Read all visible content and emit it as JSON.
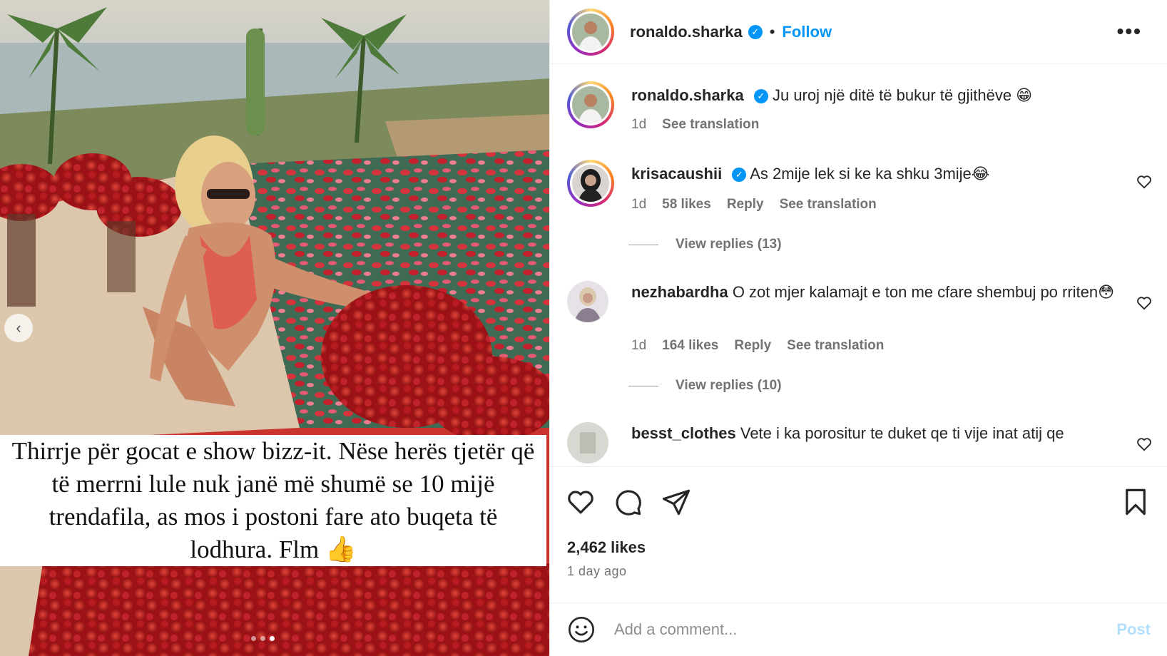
{
  "media": {
    "caption": "Thirrje për gocat e show bizz-it. Nëse herës tjetër që të merrni lule nuk janë më shumë se 10 mijë trendafila, as mos i postoni fare ato buqeta të lodhura. Flm 👍",
    "prev_icon": "chevron-left-icon",
    "dots_total": 3,
    "dots_active": 3
  },
  "header": {
    "username": "ronaldo.sharka",
    "separator": "•",
    "follow_label": "Follow",
    "more_label": "•••"
  },
  "caption_comment": {
    "username": "ronaldo.sharka",
    "text": "Ju uroj një ditë të bukur të gjithëve 😁",
    "time": "1d",
    "see_translation": "See translation"
  },
  "comments": [
    {
      "username": "krisacaushii",
      "verified": true,
      "text": "As 2mije lek si ke ka shku 3mije😂",
      "time": "1d",
      "likes": "58 likes",
      "reply": "Reply",
      "see_translation": "See translation",
      "view_replies": "View replies (13)"
    },
    {
      "username": "nezhabardha",
      "verified": false,
      "text": "O zot mjer kalamajt e ton me cfare shembuj po rriten😳",
      "time": "1d",
      "likes": "164 likes",
      "reply": "Reply",
      "see_translation": "See translation",
      "view_replies": "View replies (10)"
    },
    {
      "username": "besst_clothes",
      "verified": false,
      "text": "Vete i ka porositur te duket qe ti vije inat atij qe"
    }
  ],
  "actions": {
    "likes": "2,462 likes",
    "time_ago": "1 day ago"
  },
  "add_comment": {
    "placeholder": "Add a comment...",
    "post_label": "Post"
  },
  "colors": {
    "accent": "#0095f6",
    "post_disabled": "#b2dffc",
    "meta_gray": "#737373"
  }
}
